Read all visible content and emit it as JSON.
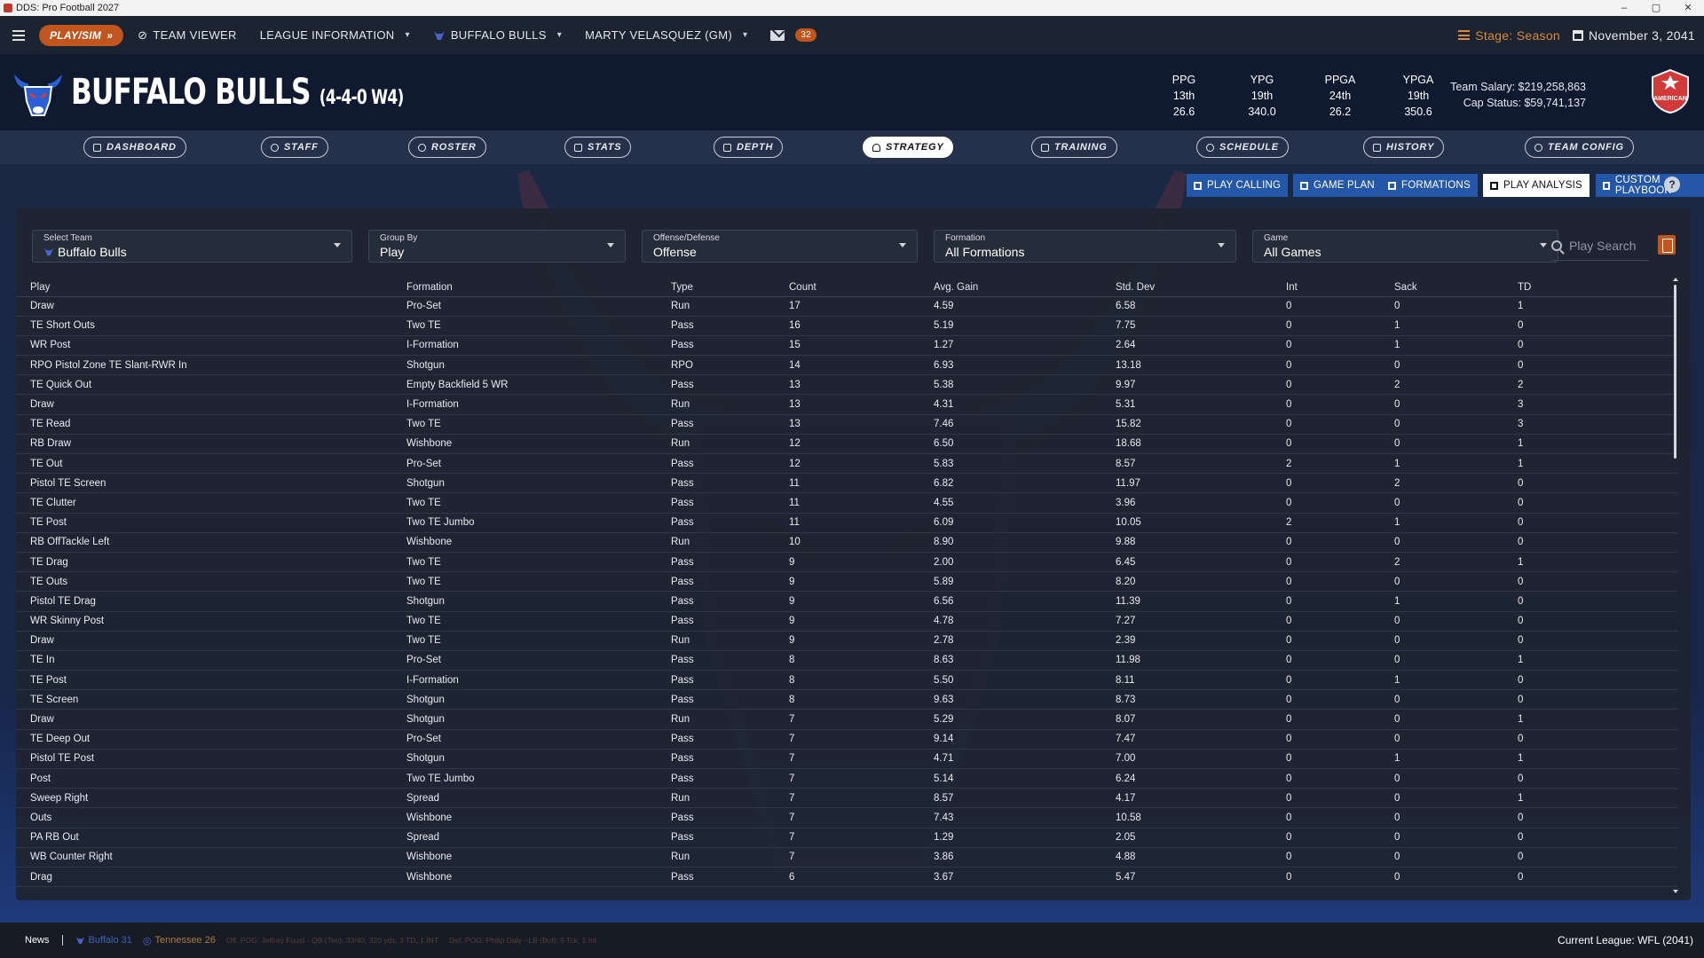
{
  "window": {
    "title": "DDS: Pro Football 2027",
    "controls": [
      "–",
      "▢",
      "✕"
    ]
  },
  "topnav": {
    "play_sim": "PLAY/SIM",
    "team_viewer": "TEAM VIEWER",
    "league_information": "LEAGUE INFORMATION",
    "team": "BUFFALO BULLS",
    "gm": "MARTY VELASQUEZ (GM)",
    "mail_count": "32",
    "stage": "Stage: Season",
    "date": "November 3, 2041"
  },
  "header": {
    "team_name": "BUFFALO BULLS",
    "record": "(4-4-0 W4)",
    "stats": [
      {
        "label": "PPG",
        "rank": "13th",
        "value": "26.6"
      },
      {
        "label": "YPG",
        "rank": "19th",
        "value": "340.0"
      },
      {
        "label": "PPGA",
        "rank": "24th",
        "value": "26.2"
      },
      {
        "label": "YPGA",
        "rank": "19th",
        "value": "350.6"
      }
    ],
    "team_salary": "Team Salary: $219,258,863",
    "cap_status": "Cap Status: $59,741,137",
    "conference_logo_text": "AMERICAN"
  },
  "tabs": [
    {
      "label": "DASHBOARD",
      "active": false
    },
    {
      "label": "STAFF",
      "active": false
    },
    {
      "label": "ROSTER",
      "active": false
    },
    {
      "label": "STATS",
      "active": false
    },
    {
      "label": "DEPTH",
      "active": false
    },
    {
      "label": "STRATEGY",
      "active": true
    },
    {
      "label": "TRAINING",
      "active": false
    },
    {
      "label": "SCHEDULE",
      "active": false
    },
    {
      "label": "HISTORY",
      "active": false
    },
    {
      "label": "TEAM CONFIG",
      "active": false
    }
  ],
  "subtabs": [
    {
      "label": "PLAY CALLING",
      "active": false
    },
    {
      "label": "GAME PLAN",
      "active": false
    },
    {
      "label": "FORMATIONS",
      "active": false
    },
    {
      "label": "PLAY ANALYSIS",
      "active": true
    },
    {
      "label": "CUSTOM PLAYBOOK",
      "active": false
    }
  ],
  "filters": {
    "team": {
      "label": "Select Team",
      "value": "Buffalo Bulls"
    },
    "group_by": {
      "label": "Group By",
      "value": "Play"
    },
    "side": {
      "label": "Offense/Defense",
      "value": "Offense"
    },
    "formation": {
      "label": "Formation",
      "value": "All Formations"
    },
    "game": {
      "label": "Game",
      "value": "All Games"
    },
    "search_placeholder": "Play Search"
  },
  "table": {
    "columns": [
      "Play",
      "Formation",
      "Type",
      "Count",
      "Avg. Gain",
      "Std. Dev",
      "Int",
      "Sack",
      "TD"
    ],
    "rows": [
      [
        "Draw",
        "Pro-Set",
        "Run",
        "17",
        "4.59",
        "6.58",
        "0",
        "0",
        "1"
      ],
      [
        "TE Short Outs",
        "Two TE",
        "Pass",
        "16",
        "5.19",
        "7.75",
        "0",
        "1",
        "0"
      ],
      [
        "WR Post",
        "I-Formation",
        "Pass",
        "15",
        "1.27",
        "2.64",
        "0",
        "1",
        "0"
      ],
      [
        "RPO Pistol Zone TE Slant-RWR In",
        "Shotgun",
        "RPO",
        "14",
        "6.93",
        "13.18",
        "0",
        "0",
        "0"
      ],
      [
        "TE Quick Out",
        "Empty Backfield 5 WR",
        "Pass",
        "13",
        "5.38",
        "9.97",
        "0",
        "2",
        "2"
      ],
      [
        "Draw",
        "I-Formation",
        "Run",
        "13",
        "4.31",
        "5.31",
        "0",
        "0",
        "3"
      ],
      [
        "TE Read",
        "Two TE",
        "Pass",
        "13",
        "7.46",
        "15.82",
        "0",
        "0",
        "3"
      ],
      [
        "RB Draw",
        "Wishbone",
        "Run",
        "12",
        "6.50",
        "18.68",
        "0",
        "0",
        "1"
      ],
      [
        "TE Out",
        "Pro-Set",
        "Pass",
        "12",
        "5.83",
        "8.57",
        "2",
        "1",
        "1"
      ],
      [
        "Pistol TE Screen",
        "Shotgun",
        "Pass",
        "11",
        "6.82",
        "11.97",
        "0",
        "2",
        "0"
      ],
      [
        "TE Clutter",
        "Two TE",
        "Pass",
        "11",
        "4.55",
        "3.96",
        "0",
        "0",
        "0"
      ],
      [
        "TE Post",
        "Two TE Jumbo",
        "Pass",
        "11",
        "6.09",
        "10.05",
        "2",
        "1",
        "0"
      ],
      [
        "RB OffTackle Left",
        "Wishbone",
        "Run",
        "10",
        "8.90",
        "9.88",
        "0",
        "0",
        "0"
      ],
      [
        "TE Drag",
        "Two TE",
        "Pass",
        "9",
        "2.00",
        "6.45",
        "0",
        "2",
        "1"
      ],
      [
        "TE Outs",
        "Two TE",
        "Pass",
        "9",
        "5.89",
        "8.20",
        "0",
        "0",
        "0"
      ],
      [
        "Pistol TE Drag",
        "Shotgun",
        "Pass",
        "9",
        "6.56",
        "11.39",
        "0",
        "1",
        "0"
      ],
      [
        "WR Skinny Post",
        "Two TE",
        "Pass",
        "9",
        "4.78",
        "7.27",
        "0",
        "0",
        "0"
      ],
      [
        "Draw",
        "Two TE",
        "Run",
        "9",
        "2.78",
        "2.39",
        "0",
        "0",
        "0"
      ],
      [
        "TE In",
        "Pro-Set",
        "Pass",
        "8",
        "8.63",
        "11.98",
        "0",
        "0",
        "1"
      ],
      [
        "TE Post",
        "I-Formation",
        "Pass",
        "8",
        "5.50",
        "8.11",
        "0",
        "1",
        "0"
      ],
      [
        "TE Screen",
        "Shotgun",
        "Pass",
        "8",
        "9.63",
        "8.73",
        "0",
        "0",
        "0"
      ],
      [
        "Draw",
        "Shotgun",
        "Run",
        "7",
        "5.29",
        "8.07",
        "0",
        "0",
        "1"
      ],
      [
        "TE Deep Out",
        "Pro-Set",
        "Pass",
        "7",
        "9.14",
        "7.47",
        "0",
        "0",
        "0"
      ],
      [
        "Pistol TE Post",
        "Shotgun",
        "Pass",
        "7",
        "4.71",
        "7.00",
        "0",
        "1",
        "1"
      ],
      [
        "Post",
        "Two TE Jumbo",
        "Pass",
        "7",
        "5.14",
        "6.24",
        "0",
        "0",
        "0"
      ],
      [
        "Sweep Right",
        "Spread",
        "Run",
        "7",
        "8.57",
        "4.17",
        "0",
        "0",
        "1"
      ],
      [
        "Outs",
        "Wishbone",
        "Pass",
        "7",
        "7.43",
        "10.58",
        "0",
        "0",
        "0"
      ],
      [
        "PA RB Out",
        "Spread",
        "Pass",
        "7",
        "1.29",
        "2.05",
        "0",
        "0",
        "0"
      ],
      [
        "WB Counter Right",
        "Wishbone",
        "Run",
        "7",
        "3.86",
        "4.88",
        "0",
        "0",
        "0"
      ],
      [
        "Drag",
        "Wishbone",
        "Pass",
        "6",
        "3.67",
        "5.47",
        "0",
        "0",
        "0"
      ]
    ]
  },
  "footer": {
    "news_label": "News",
    "score_home": "Buffalo 31",
    "score_away": "Tennessee 26",
    "off_pog": "Off. POG: Jeffrey Foust - QB (Ten): 33/40, 320 yds, 3 TD, 1 INT",
    "def_pog": "Def. POG: Philip Daly - LB (Buf): 5 Tck, 1 Int",
    "current_league": "Current League: WFL (2041)"
  },
  "colors": {
    "accent_orange": "#c0551e",
    "subtab_blue": "#2557a8",
    "stage_orange": "#d68a3c"
  }
}
